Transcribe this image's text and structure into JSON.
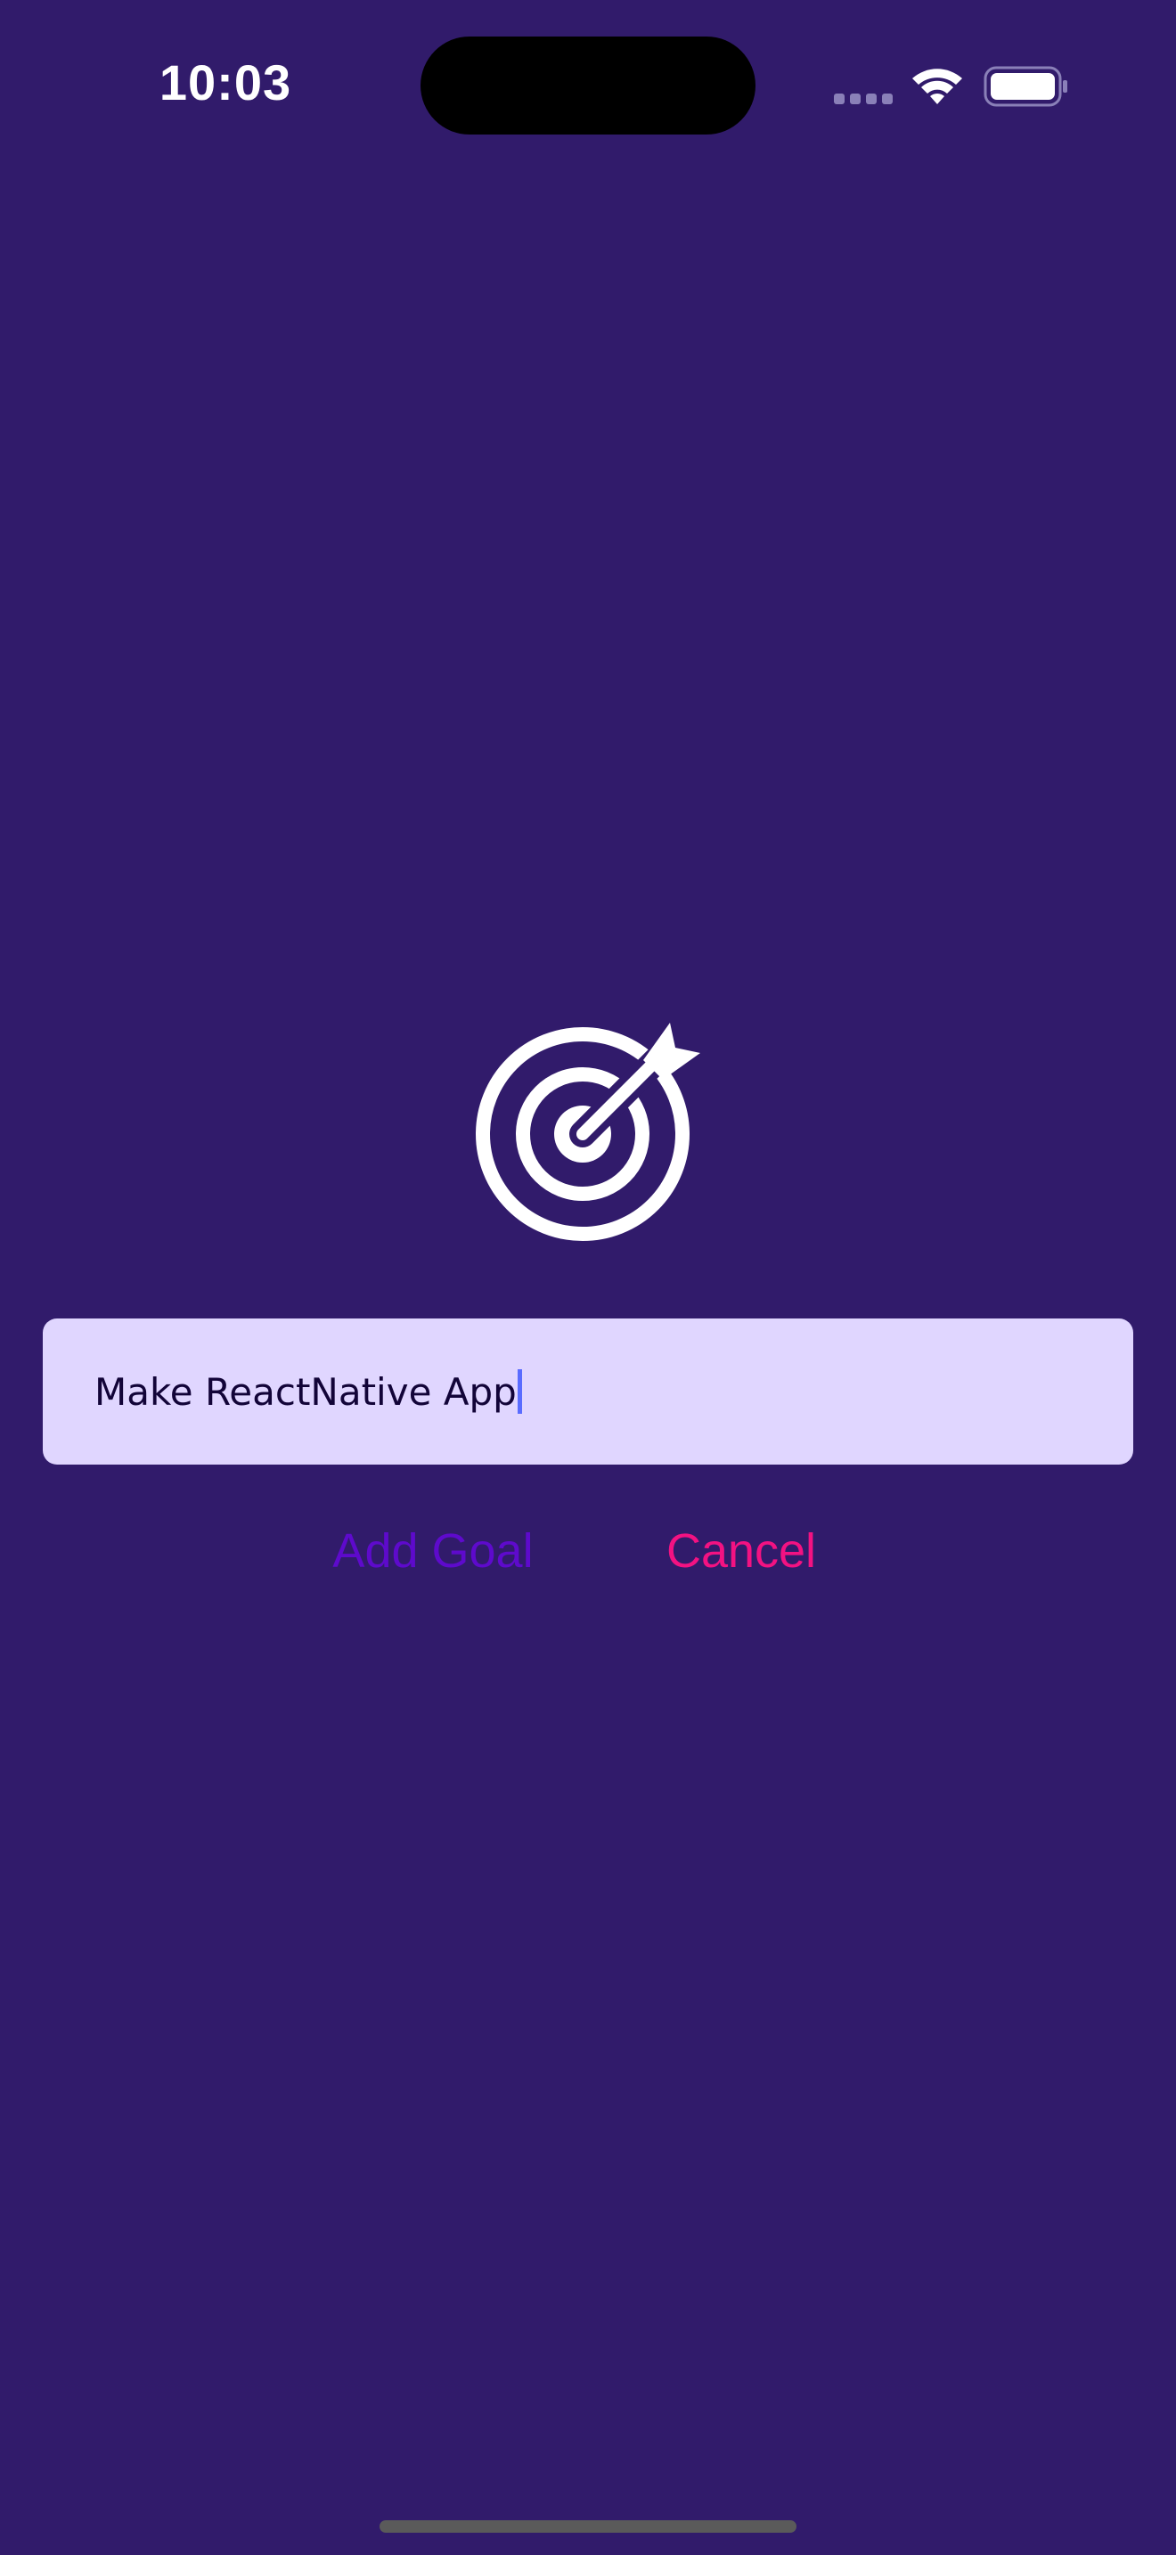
{
  "status_bar": {
    "time": "10:03",
    "icons": [
      "cellular-signal-icon",
      "wifi-icon",
      "battery-icon"
    ]
  },
  "goal_screen": {
    "icon": "target-goal-icon",
    "input_value": "Make ReactNative App",
    "buttons": {
      "add_goal_label": "Add Goal",
      "cancel_label": "Cancel"
    }
  },
  "colors": {
    "background": "#311b6b",
    "input_background": "#e0d6ff",
    "add_goal": "#5e0acc",
    "cancel": "#f31282"
  }
}
